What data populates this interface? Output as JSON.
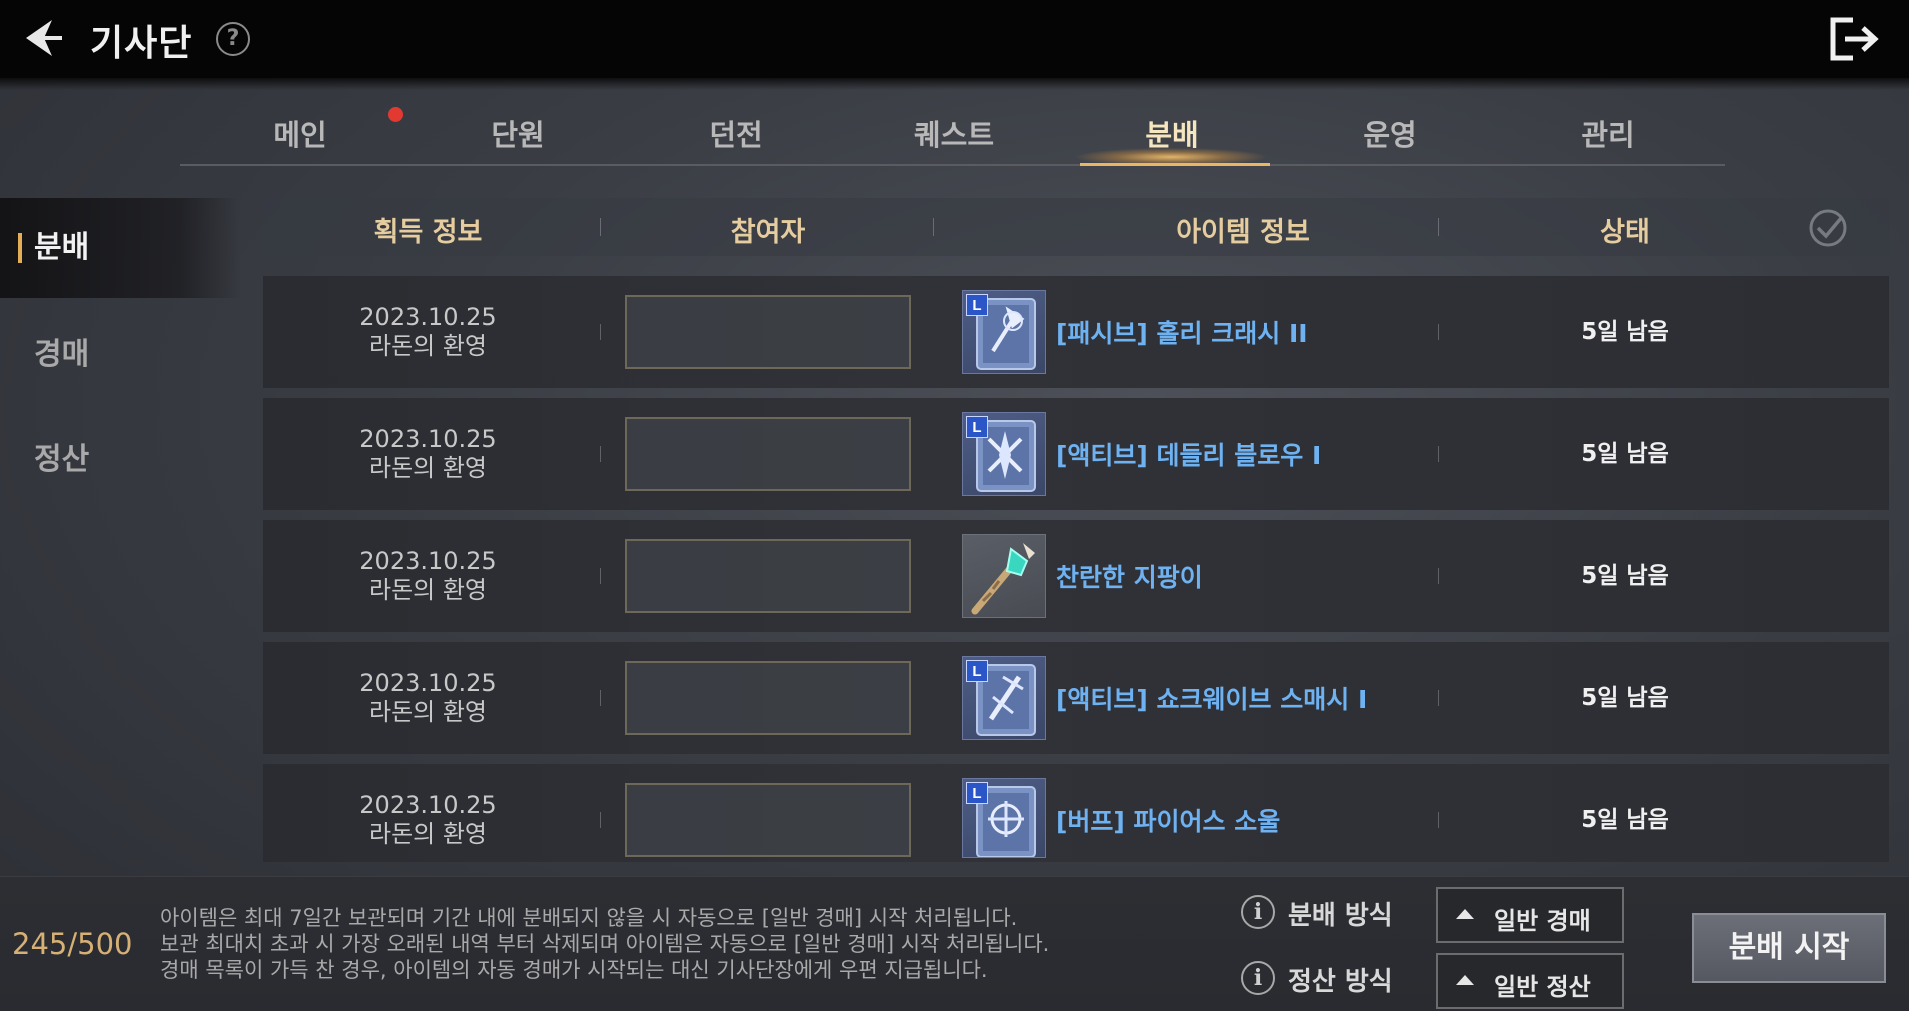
{
  "header": {
    "title": "기사단",
    "help_icon_text": "?"
  },
  "tabs": [
    {
      "label": "메인"
    },
    {
      "label": "단원"
    },
    {
      "label": "던전"
    },
    {
      "label": "퀘스트"
    },
    {
      "label": "분배",
      "active": true
    },
    {
      "label": "운영"
    },
    {
      "label": "관리"
    }
  ],
  "sidebar": {
    "items": [
      {
        "label": "분배",
        "active": true
      },
      {
        "label": "경매"
      },
      {
        "label": "정산"
      }
    ]
  },
  "table": {
    "columns": [
      "획득 정보",
      "참여자",
      "아이템 정보",
      "상태"
    ],
    "rows": [
      {
        "date": "2023.10.25",
        "source": "라돈의 환영",
        "participant": "",
        "item_name": "[패시브] 홀리 크래시 II",
        "item_grade": "L",
        "item_icon": "skill-book-icon",
        "status": "5일 남음"
      },
      {
        "date": "2023.10.25",
        "source": "라돈의 환영",
        "participant": "",
        "item_name": "[액티브] 데들리 블로우 I",
        "item_grade": "L",
        "item_icon": "skill-book-icon",
        "status": "5일 남음"
      },
      {
        "date": "2023.10.25",
        "source": "라돈의 환영",
        "participant": "",
        "item_name": "찬란한 지팡이",
        "item_grade": "",
        "item_icon": "staff-icon",
        "status": "5일 남음"
      },
      {
        "date": "2023.10.25",
        "source": "라돈의 환영",
        "participant": "",
        "item_name": "[액티브] 쇼크웨이브 스매시 I",
        "item_grade": "L",
        "item_icon": "skill-book-icon",
        "status": "5일 남음"
      },
      {
        "date": "2023.10.25",
        "source": "라돈의 환영",
        "participant": "",
        "item_name": "[버프] 파이어스 소울",
        "item_grade": "L",
        "item_icon": "skill-book-icon",
        "status": "5일 남음"
      }
    ]
  },
  "footer": {
    "count": "245/500",
    "notice": [
      "아이템은 최대 7일간 보관되며 기간 내에 분배되지 않을 시 자동으로 [일반 경매] 시작 처리됩니다.",
      "보관 최대치 초과 시 가장 오래된 내역 부터 삭제되며 아이템은 자동으로 [일반 경매] 시작 처리됩니다.",
      "경매 목록이 가득 찬 경우, 아이템의 자동 경매가 시작되는 대신 기사단장에게 우편 지급됩니다."
    ],
    "distribution_method_label": "분배 방식",
    "distribution_method_value": "일반 경매",
    "settlement_method_label": "정산 방식",
    "settlement_method_value": "일반 정산",
    "start_button": "분배 시작",
    "info_icon_text": "i"
  },
  "colors": {
    "accent_gold": "#e4ad58",
    "item_name_blue": "#6fb2f2",
    "header_gold": "#e6cda0",
    "notification_red": "#e23a31",
    "legendary_badge": "#2a56c8"
  }
}
